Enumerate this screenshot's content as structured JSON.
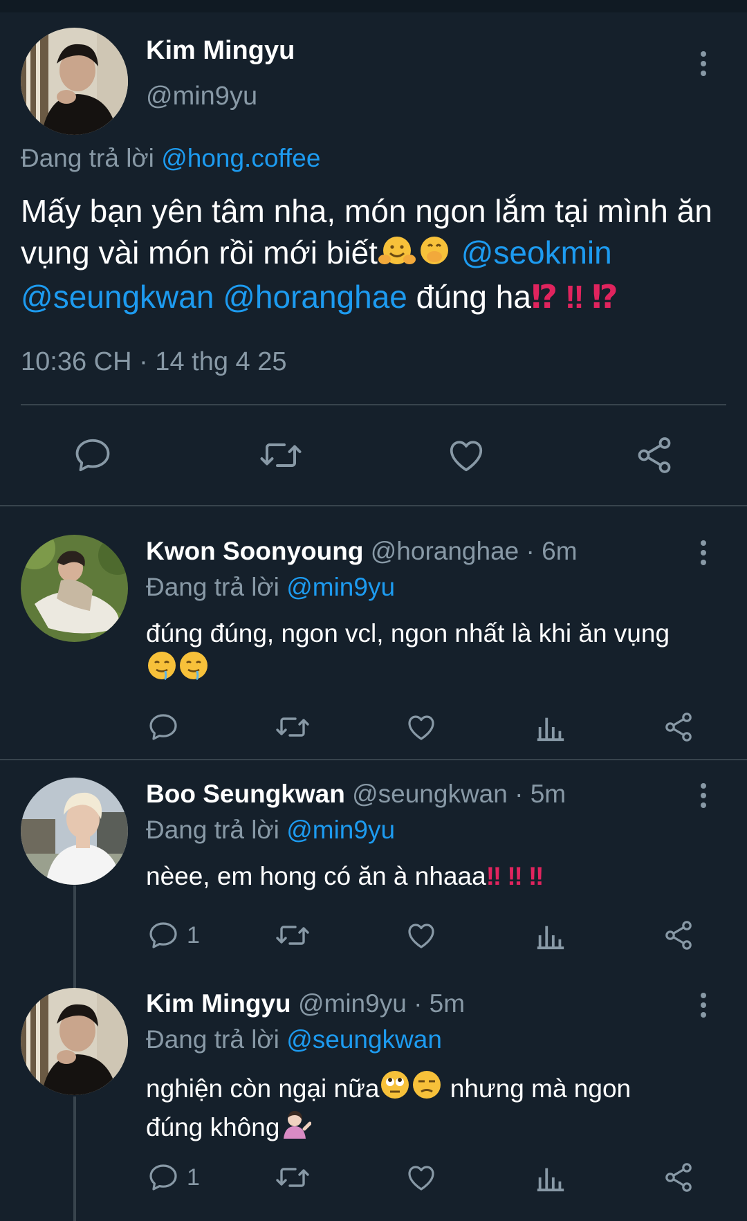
{
  "main_tweet": {
    "name": "Kim Mingyu",
    "handle": "@min9yu",
    "reply_prefix": "Đang trả lời",
    "reply_to": "@hong.coffee",
    "body_text_1": "Mấy bạn yên tâm nha, món ngon lắm tại mình ăn vụng vài món rồi mới biết",
    "mention_1": "@seokmin",
    "mention_2": "@seungkwan",
    "mention_3": "@horanghae",
    "body_text_2": "đúng ha",
    "exclaim_1": "⁉",
    "exclaim_2": "‼",
    "exclaim_3": "⁉",
    "timestamp": "10:36 CH · 14 thg 4 25"
  },
  "replies": [
    {
      "name": "Kwon Soonyoung",
      "handle": "@horanghae",
      "time": "· 6m",
      "reply_prefix": "Đang trả lời",
      "reply_to": "@min9yu",
      "text": "đúng đúng, ngon vcl, ngon nhất là khi ăn vụng",
      "reply_count": ""
    },
    {
      "name": "Boo Seungkwan",
      "handle": "@seungkwan",
      "time": "· 5m",
      "reply_prefix": "Đang trả lời",
      "reply_to": "@min9yu",
      "text": "nèee, em hong có ăn à nhaaa",
      "exclaim": "‼",
      "reply_count": "1"
    },
    {
      "name": "Kim Mingyu",
      "handle": "@min9yu",
      "time": "· 5m",
      "reply_prefix": "Đang trả lời",
      "reply_to": "@seungkwan",
      "text_1": "nghiện còn ngại nữa",
      "text_2": "nhưng mà ngon",
      "text_3": "đúng không",
      "reply_count": "1"
    }
  ],
  "colors": {
    "background": "#15202b",
    "link": "#1d9bf0",
    "muted": "#8899a6",
    "divider": "#38444d",
    "alert": "#e0245e"
  },
  "icons": [
    "reply-icon",
    "retweet-icon",
    "like-icon",
    "analytics-icon",
    "share-icon",
    "more-icon"
  ]
}
